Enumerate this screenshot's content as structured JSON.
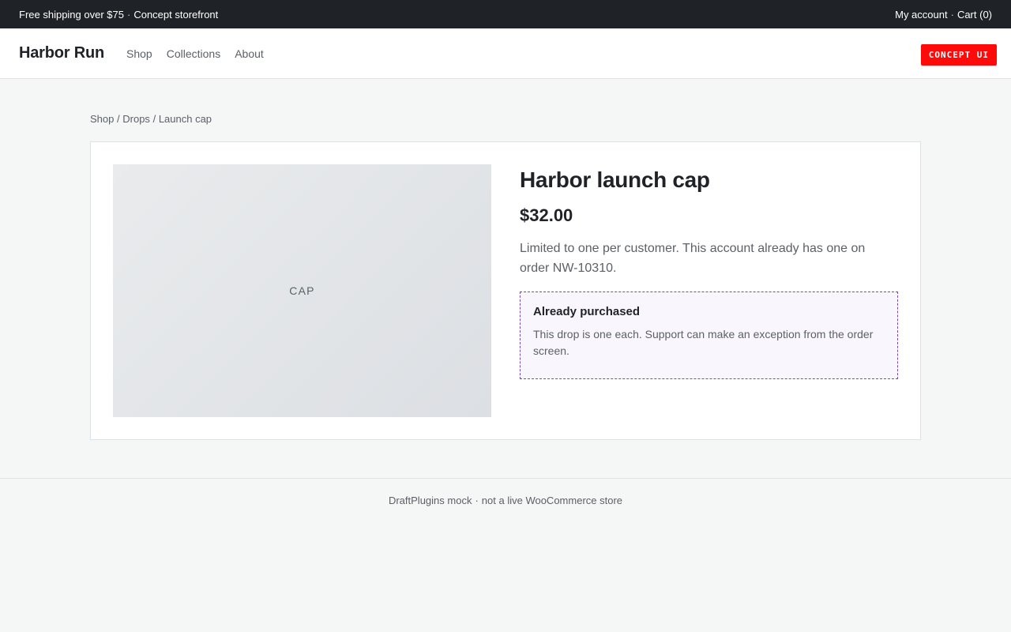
{
  "topbar": {
    "promo": "Free shipping over $75",
    "tagline": "Concept storefront",
    "account_link": "My account",
    "cart_link": "Cart (0)",
    "separator": "·"
  },
  "header": {
    "logo": "Harbor Run",
    "nav": [
      {
        "label": "Shop"
      },
      {
        "label": "Collections"
      },
      {
        "label": "About"
      }
    ],
    "badge": "CONCEPT UI"
  },
  "breadcrumb": {
    "items": [
      "Shop",
      "Drops",
      "Launch cap"
    ],
    "separator": "/"
  },
  "product": {
    "image_label": "CAP",
    "title": "Harbor launch cap",
    "price": "$32.00",
    "description": "Limited to one per customer. This account already has one on order NW-10310.",
    "notice": {
      "title": "Already purchased",
      "text": "This drop is one each. Support can make an exception from the order screen."
    }
  },
  "footer": {
    "left": "DraftPlugins mock",
    "right": "not a live WooCommerce store",
    "separator": "·"
  },
  "colors": {
    "topbar_bg": "#1f2327",
    "badge_bg": "#ff0a0a",
    "notice_border": "#7b4aa8",
    "notice_bg": "#faf6fd",
    "page_bg": "#f5f6f6"
  }
}
